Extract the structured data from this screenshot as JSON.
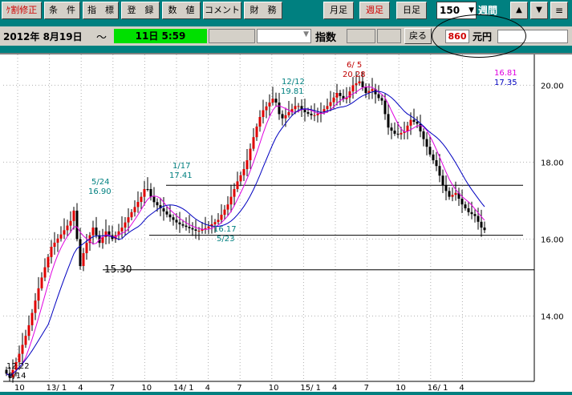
{
  "toolbar": {
    "buttons": [
      {
        "label": "ｹ割修正"
      },
      {
        "label": "条　件"
      },
      {
        "label": "指　標"
      },
      {
        "label": "登　録"
      },
      {
        "label": "数　値"
      },
      {
        "label": "コメント"
      },
      {
        "label": "財　務"
      },
      {
        "label": "月足"
      },
      {
        "label": "週足"
      },
      {
        "label": "日足"
      }
    ],
    "period_value": "150",
    "period_unit": "週間",
    "up_icon": "triangle-up-icon",
    "down_icon": "triangle-down-icon",
    "menu_icon": "hamburger-icon"
  },
  "infobar": {
    "date": "2012年  8月19日",
    "tilde": "～",
    "duration": "11日   5:59",
    "index_label": "指数",
    "back_label": "戻る",
    "unit_value": "860",
    "unit_label": "元円"
  },
  "colors": {
    "ma_short": "#e000e0",
    "ma_long": "#0000c0",
    "annotation": "#008080",
    "high_label": "#c00000"
  },
  "chart_data": {
    "type": "candlestick",
    "ylim": [
      12.3,
      20.8
    ],
    "yticks": [
      20.0,
      18.0,
      16.0,
      14.0
    ],
    "ytick_labels": [
      "20.00",
      "18.00",
      "16.00",
      "14.00"
    ],
    "xtick_labels": [
      "10",
      "13/ 1",
      "4",
      "7",
      "10",
      "14/ 1",
      "4",
      "7",
      "10",
      "15/ 1",
      "4",
      "7",
      "10",
      "16/ 1",
      "4"
    ],
    "legend": [
      {
        "label": "16.81",
        "color": "#e000e0"
      },
      {
        "label": "17.35",
        "color": "#0000c0"
      }
    ],
    "horizontal_lines": [
      17.4,
      16.1,
      15.2
    ],
    "annotations": [
      {
        "date": "12/22",
        "value": "12.22"
      },
      {
        "date": "9/14",
        "value": ""
      },
      {
        "date": "5/24",
        "value": "16.90"
      },
      {
        "date": "",
        "value": "15.30"
      },
      {
        "date": "1/17",
        "value": "17.41"
      },
      {
        "date": "5/23",
        "value": "16.17"
      },
      {
        "date": "12/12",
        "value": "19.81"
      },
      {
        "date": "6/ 5",
        "value": "20.28"
      }
    ]
  }
}
